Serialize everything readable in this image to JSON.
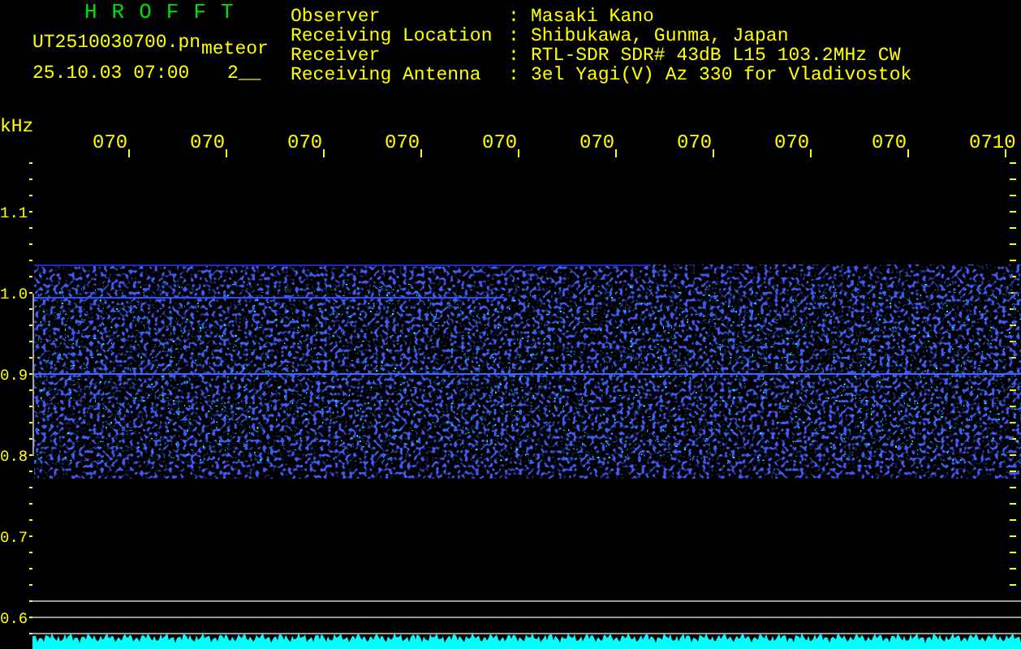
{
  "header": {
    "title": "HROFFT",
    "file_name": "UT2510030700.pn",
    "mode": "meteor",
    "date_time": "25.10.03 07:00",
    "counter": "2__"
  },
  "info": [
    {
      "label": "Observer",
      "separator": ":",
      "value": "Masaki Kano"
    },
    {
      "label": "Receiving Location",
      "separator": ":",
      "value": "Shibukawa, Gunma, Japan"
    },
    {
      "label": "Receiver",
      "separator": ":",
      "value": "RTL-SDR SDR# 43dB L15 103.2MHz CW"
    },
    {
      "label": "Receiving Antenna",
      "separator": ":",
      "value": "3el Yagi(V) Az 330 for Vladivostok"
    }
  ],
  "frequency_axis": {
    "unit": "kHz",
    "labels": [
      "1.1",
      "1.0",
      "0.9",
      "0.8",
      "0.7",
      "0.6"
    ]
  },
  "time_axis": {
    "labels": [
      "070",
      "070",
      "070",
      "070",
      "070",
      "070",
      "070",
      "070",
      "070",
      "0710"
    ]
  }
}
